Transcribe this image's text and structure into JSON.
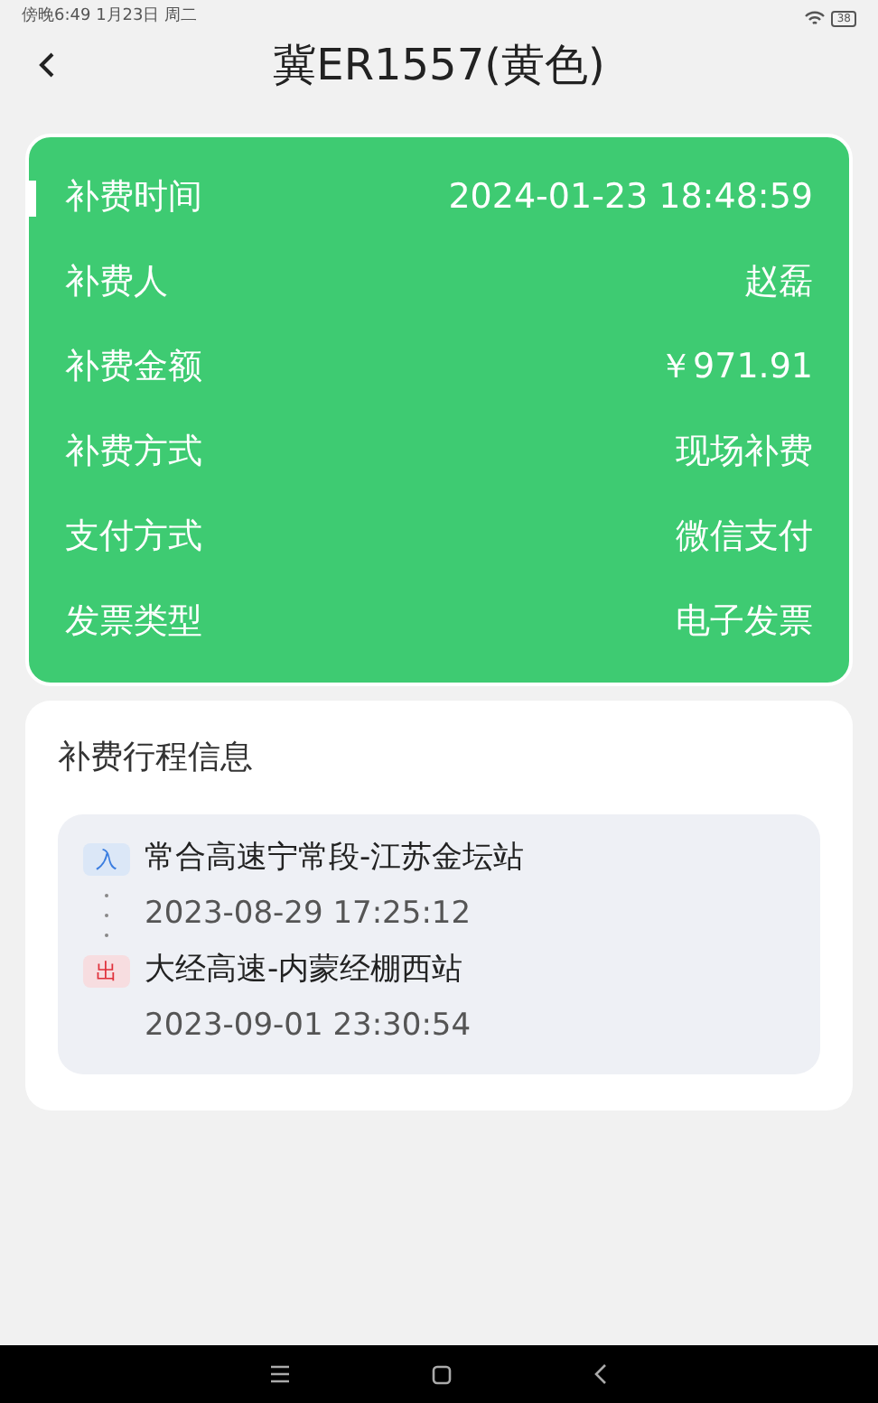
{
  "status_bar": {
    "time": "傍晚6:49 1月23日 周二",
    "battery": "38"
  },
  "header": {
    "title": "冀ER1557(黄色)"
  },
  "details": [
    {
      "label": "补费时间",
      "value": "2024-01-23 18:48:59",
      "selected": true
    },
    {
      "label": "补费人",
      "value": "赵磊",
      "selected": false
    },
    {
      "label": "补费金额",
      "value": "￥971.91",
      "selected": false
    },
    {
      "label": "补费方式",
      "value": "现场补费",
      "selected": false
    },
    {
      "label": "支付方式",
      "value": "微信支付",
      "selected": false
    },
    {
      "label": "发票类型",
      "value": "电子发票",
      "selected": false
    }
  ],
  "trip": {
    "title": "补费行程信息",
    "stops": [
      {
        "kind": "entry",
        "badge": "入",
        "station": "常合高速宁常段-江苏金坛站",
        "time": "2023-08-29 17:25:12"
      },
      {
        "kind": "exit",
        "badge": "出",
        "station": "大经高速-内蒙经棚西站",
        "time": "2023-09-01 23:30:54"
      }
    ]
  }
}
